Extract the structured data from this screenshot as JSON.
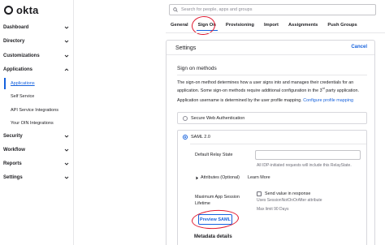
{
  "app": {
    "logo_text": "okta"
  },
  "sidebar": {
    "items": [
      {
        "label": "Dashboard"
      },
      {
        "label": "Directory"
      },
      {
        "label": "Customizations"
      },
      {
        "label": "Applications"
      },
      {
        "label": "Security"
      },
      {
        "label": "Workflow"
      },
      {
        "label": "Reports"
      },
      {
        "label": "Settings"
      }
    ],
    "applications_children": [
      {
        "label": "Applications",
        "active": true
      },
      {
        "label": "Self Service"
      },
      {
        "label": "API Service Integrations"
      },
      {
        "label": "Your OIN Integrations"
      }
    ]
  },
  "search": {
    "placeholder": "Search for people, apps and groups"
  },
  "tabs": [
    {
      "label": "General"
    },
    {
      "label": "Sign On",
      "active": true
    },
    {
      "label": "Provisioning"
    },
    {
      "label": "Import"
    },
    {
      "label": "Assignments"
    },
    {
      "label": "Push Groups"
    }
  ],
  "panel": {
    "title": "Settings",
    "cancel_label": "Cancel",
    "section_title": "Sign on methods",
    "description_part1": "The sign-on method determines how a user signs into and manages their credentials for an application. Some sign-on methods require additional configuration in the 3",
    "description_sup": "rd",
    "description_part2": " party application.",
    "username_text": "Application username is determined by the user profile mapping.",
    "username_link": "Configure profile mapping",
    "option_swa": "Secure Web Authentication",
    "option_saml": "SAML 2.0",
    "relay_label": "Default Relay State",
    "relay_value": "",
    "relay_hint": "All IDP-initiated requests will include this RelayState.",
    "attributes_label": "Attributes (Optional)",
    "learn_more": "Learn More",
    "max_session_label_line1": "Maximum App Session",
    "max_session_label_line2": "Lifetime",
    "send_value_label": "Send value in response",
    "session_hint1": "Uses SessionNotOnOrAfter attribute",
    "session_hint2": "Max limit 90 Days",
    "preview_button": "Preview SAML",
    "metadata_title": "Metadata details"
  },
  "colors": {
    "accent": "#1662dd",
    "annotation_red": "#e0182f"
  }
}
